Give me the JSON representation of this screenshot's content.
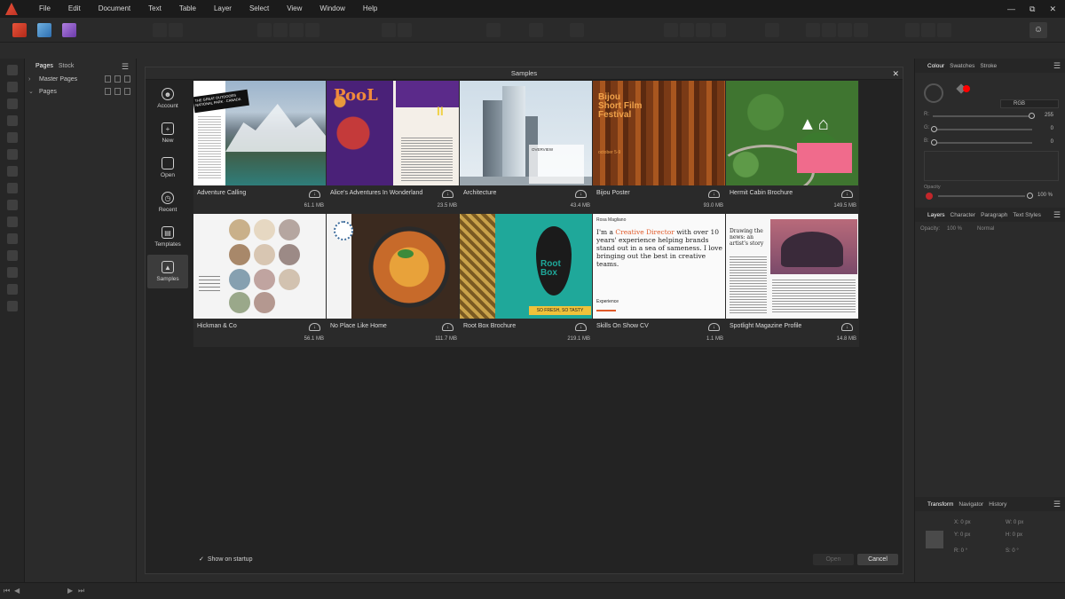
{
  "menu": [
    "File",
    "Edit",
    "Document",
    "Text",
    "Table",
    "Layer",
    "Select",
    "View",
    "Window",
    "Help"
  ],
  "window_controls": {
    "minimize": "—",
    "restore": "⧉",
    "close": "✕"
  },
  "user_icon": "user-icon",
  "pages_panel": {
    "tabs": [
      "Pages",
      "Stock"
    ],
    "rows": [
      "Master Pages",
      "Pages"
    ]
  },
  "dialog": {
    "title": "Samples",
    "close": "✕",
    "nav": [
      {
        "label": "Account",
        "icon": "account-icon"
      },
      {
        "label": "New",
        "icon": "new-document-icon"
      },
      {
        "label": "Open",
        "icon": "folder-icon"
      },
      {
        "label": "Recent",
        "icon": "clock-icon"
      },
      {
        "label": "Templates",
        "icon": "templates-icon"
      },
      {
        "label": "Samples",
        "icon": "image-icon"
      }
    ],
    "active_nav": "Samples",
    "samples": [
      {
        "name": "Adventure Calling",
        "size": "61.1 MB"
      },
      {
        "name": "Alice's Adventures In Wonderland",
        "size": "23.5 MB"
      },
      {
        "name": "Architecture",
        "size": "43.4 MB"
      },
      {
        "name": "Bijou Poster",
        "size": "93.0 MB"
      },
      {
        "name": "Hermit Cabin Brochure",
        "size": "149.5 MB"
      },
      {
        "name": "Hickman & Co",
        "size": "56.1 MB"
      },
      {
        "name": "No Place Like Home",
        "size": "111.7 MB"
      },
      {
        "name": "Root Box Brochure",
        "size": "219.1 MB"
      },
      {
        "name": "Skills On Show CV",
        "size": "1.1 MB"
      },
      {
        "name": "Spotlight Magazine Profile",
        "size": "14.8 MB"
      }
    ],
    "thumb_text": {
      "adventure_ribbon": "THE GREAT OUTDOORS NATIONAL PARK · CANADA",
      "alice_title": "PooL",
      "alice_num": "II",
      "arch_overview": "OVERVIEW",
      "bijou_title": "Bijou Short Film Festival",
      "bijou_date": "october 5-9",
      "rootbox_title": "Root Box",
      "rootbox_tag": "SO FRESH, SO TASTY",
      "skills_name": "Rosa Magliano",
      "skills_head_pre": "I'm a ",
      "skills_head_hl": "Creative Director",
      "skills_head_post": " with over 10 years' experience helping brands stand out in a sea of sameness. I love bringing out the best in creative teams.",
      "skills_exp": "Experience",
      "spot_title": "Drawing the news: an artist's story"
    },
    "footer": {
      "show_on_startup": "Show on startup",
      "show_on_startup_checked": true,
      "open": "Open",
      "cancel": "Cancel"
    }
  },
  "right_panel": {
    "colour_tabs": [
      "Colour",
      "Swatches",
      "Stroke"
    ],
    "colour_model": "RGB",
    "channels": [
      {
        "label": "R:",
        "value": "255"
      },
      {
        "label": "G:",
        "value": "0"
      },
      {
        "label": "B:",
        "value": "0"
      }
    ],
    "opacity_label": "Opacity",
    "opacity_value": "100 %",
    "layers_tabs": [
      "Layers",
      "Character",
      "Paragraph",
      "Text Styles"
    ],
    "layers_opacity_label": "Opacity:",
    "layers_opacity_value": "100 %",
    "blend_mode": "Normal",
    "transform_tabs": [
      "Transform",
      "Navigator",
      "History"
    ],
    "transform_fields": [
      {
        "label": "X:",
        "value": "0 px"
      },
      {
        "label": "W:",
        "value": "0 px"
      },
      {
        "label": "Y:",
        "value": "0 px"
      },
      {
        "label": "H:",
        "value": "0 px"
      },
      {
        "label": "R:",
        "value": "0 °"
      },
      {
        "label": "S:",
        "value": "0 °"
      }
    ]
  },
  "colors": {
    "accent_red": "#e8533a",
    "swatch_red": "#ff0000",
    "dialog_bg": "#232323"
  }
}
